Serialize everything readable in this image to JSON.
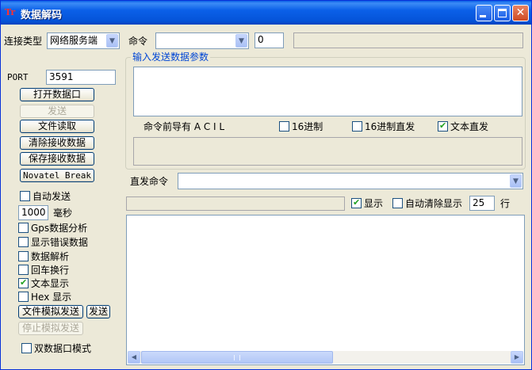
{
  "window": {
    "title": "数据解码",
    "icon_text": "Tr"
  },
  "connection": {
    "type_label": "连接类型",
    "type_value": "网络服务端",
    "port_label": "PORT",
    "port_value": "3591"
  },
  "command": {
    "label": "命令",
    "value": "",
    "count_value": "0",
    "status_value": ""
  },
  "send_params": {
    "group_title": "输入发送数据参数",
    "prefix_label": "命令前导有 A C I L",
    "hex_label": "16进制",
    "hex_checked": false,
    "hex_direct_label": "16进制直发",
    "hex_direct_checked": false,
    "text_direct_label": "文本直发",
    "text_direct_checked": true
  },
  "buttons": {
    "open_port": "打开数据口",
    "send": "发送",
    "file_read": "文件读取",
    "clear_recv": "清除接收数据",
    "save_recv": "保存接收数据",
    "novatel_break": "Novatel Break",
    "file_sim_send": "文件模拟发送",
    "send_small": "发送",
    "stop_sim_send": "停止模拟发送"
  },
  "options": {
    "auto_send_label": "自动发送",
    "auto_send_checked": false,
    "interval_value": "1000",
    "interval_unit": "毫秒",
    "gps_analysis_label": "Gps数据分析",
    "gps_analysis_checked": false,
    "show_errors_label": "显示错误数据",
    "show_errors_checked": false,
    "data_parse_label": "数据解析",
    "data_parse_checked": false,
    "newline_label": "回车换行",
    "newline_checked": false,
    "text_display_label": "文本显示",
    "text_display_checked": true,
    "hex_display_label": "Hex 显示",
    "hex_display_checked": false,
    "dual_port_label": "双数据口模式",
    "dual_port_checked": false
  },
  "direct": {
    "label": "直发命令",
    "value": ""
  },
  "display": {
    "show_label": "显示",
    "show_checked": true,
    "auto_clear_label": "自动清除显示",
    "auto_clear_checked": false,
    "lines_value": "25",
    "lines_unit": "行"
  },
  "icons": {
    "dropdown": "chevron-down-icon",
    "check": "checkmark-icon",
    "scroll_left": "arrow-left-icon",
    "scroll_right": "arrow-right-icon"
  },
  "colors": {
    "titlebar": "#0553d8",
    "group_title": "#0046d5",
    "check": "#21a121",
    "face": "#ece9d8"
  }
}
